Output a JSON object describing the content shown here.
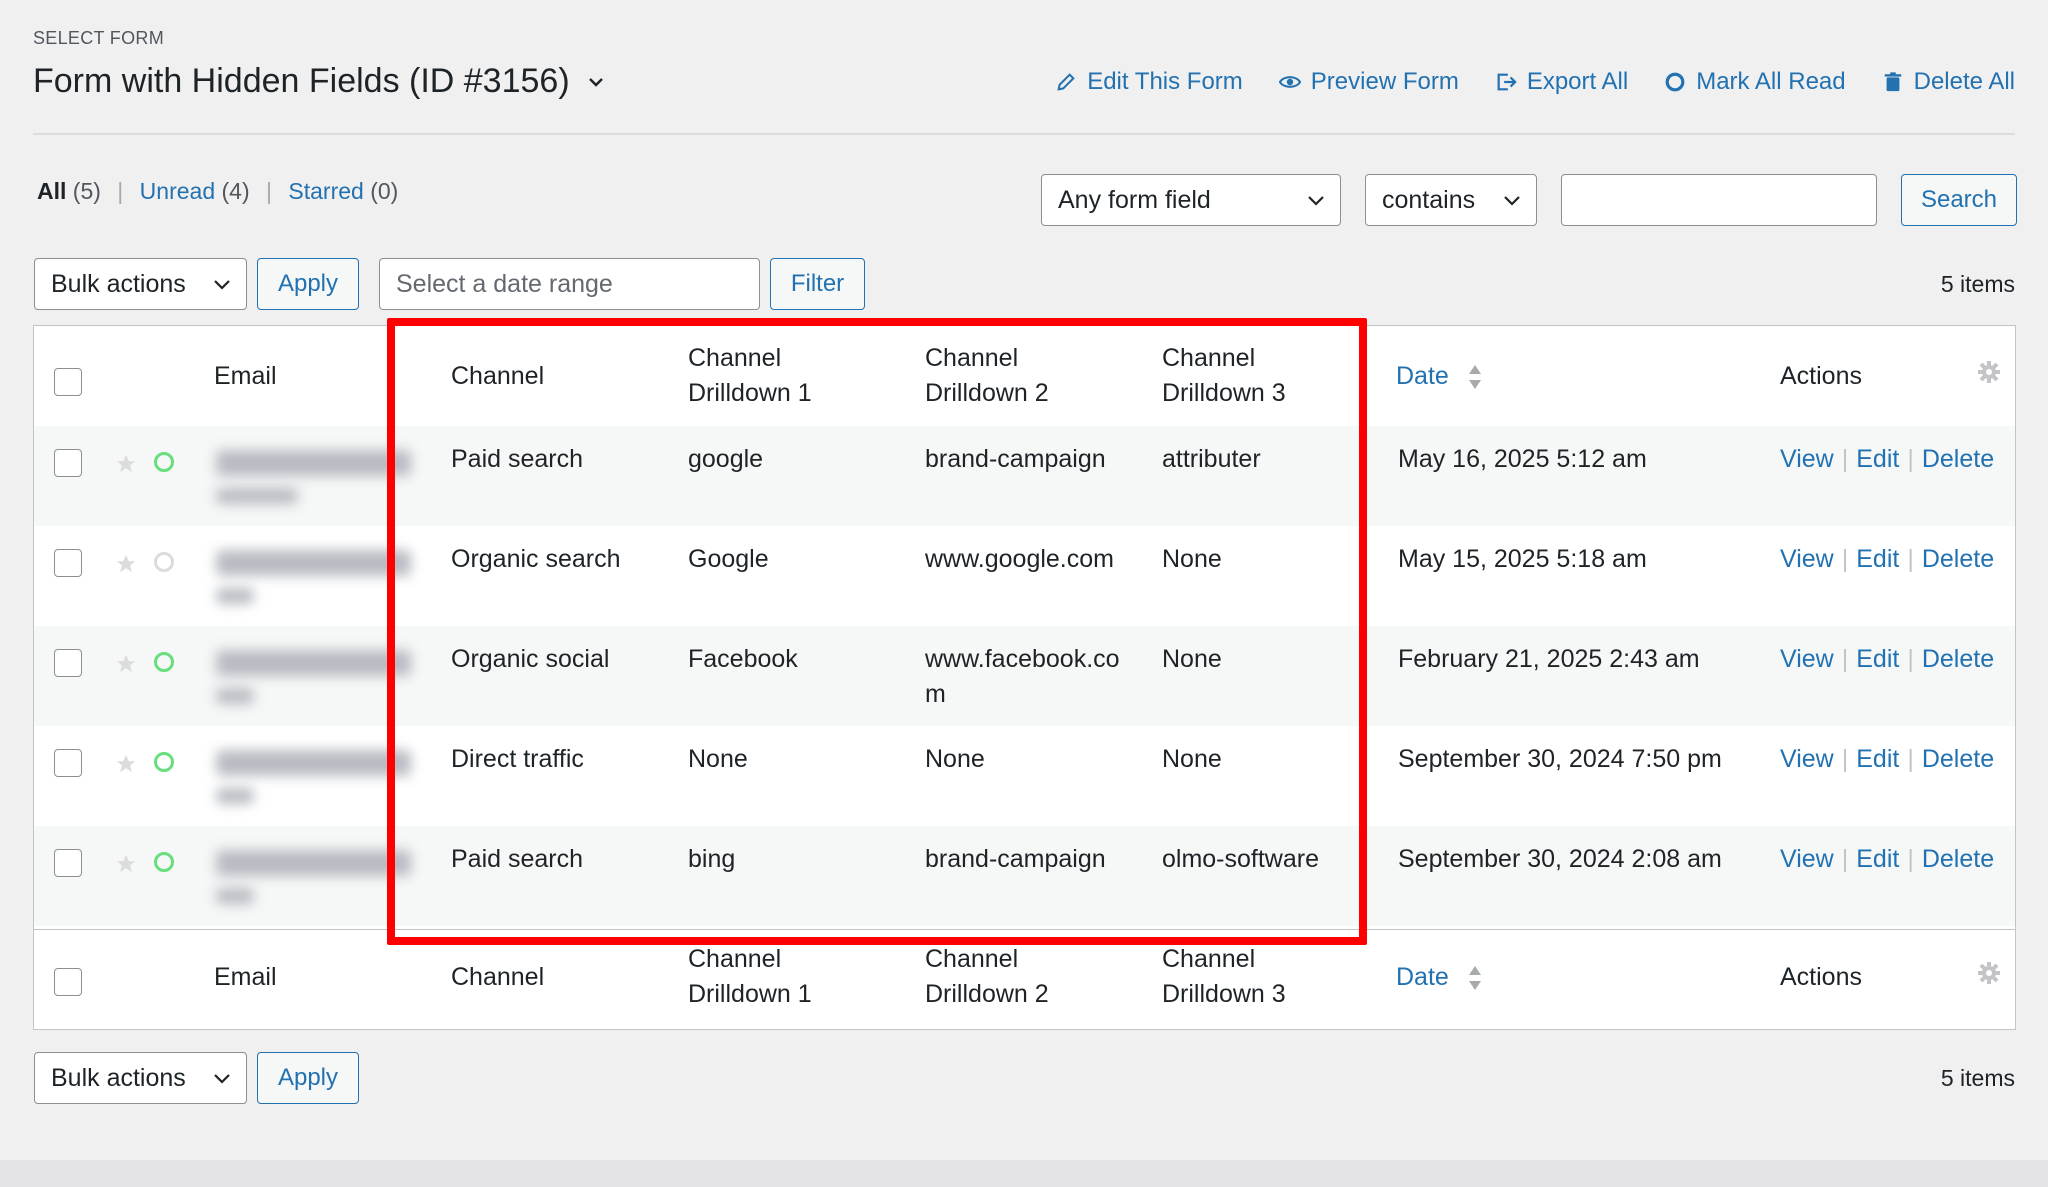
{
  "header": {
    "select_label": "SELECT FORM",
    "form_title": "Form with Hidden Fields (ID #3156)",
    "actions": [
      {
        "label": "Edit This Form",
        "icon": "pencil-icon"
      },
      {
        "label": "Preview Form",
        "icon": "eye-icon"
      },
      {
        "label": "Export All",
        "icon": "export-icon"
      },
      {
        "label": "Mark All Read",
        "icon": "circle-icon"
      },
      {
        "label": "Delete All",
        "icon": "trash-icon"
      }
    ]
  },
  "views": {
    "all_label": "All",
    "all_count": "(5)",
    "unread_label": "Unread",
    "unread_count": "(4)",
    "starred_label": "Starred",
    "starred_count": "(0)",
    "separator": "|"
  },
  "search": {
    "field_select": "Any form field",
    "operator_select": "contains",
    "query": "",
    "button": "Search"
  },
  "toolbar_top": {
    "bulk_actions": "Bulk actions",
    "apply": "Apply",
    "date_placeholder": "Select a date range",
    "filter": "Filter",
    "count": "5 items"
  },
  "toolbar_bottom": {
    "bulk_actions": "Bulk actions",
    "apply": "Apply",
    "count": "5 items"
  },
  "table": {
    "columns": {
      "email": "Email",
      "channel": "Channel",
      "d1_line1": "Channel",
      "d1_line2": "Drilldown 1",
      "d2_line1": "Channel",
      "d2_line2": "Drilldown 2",
      "d3_line1": "Channel",
      "d3_line2": "Drilldown 3",
      "date": "Date",
      "actions": "Actions"
    },
    "row_actions": {
      "view": "View",
      "edit": "Edit",
      "delete": "Delete",
      "sep": "|"
    },
    "rows": [
      {
        "channel": "Paid search",
        "d1": "google",
        "d2": "brand-campaign",
        "d2b": "",
        "d3": "attributer",
        "date": "May 16, 2025 5:12 am",
        "unread": true
      },
      {
        "channel": "Organic search",
        "d1": "Google",
        "d2": "www.google.com",
        "d2b": "",
        "d3": "None",
        "date": "May 15, 2025 5:18 am",
        "unread": false
      },
      {
        "channel": "Organic social",
        "d1": "Facebook",
        "d2": "www.facebook.co",
        "d2b": "m",
        "d3": "None",
        "date": "February 21, 2025 2:43 am",
        "unread": true
      },
      {
        "channel": "Direct traffic",
        "d1": "None",
        "d2": "None",
        "d2b": "",
        "d3": "None",
        "date": "September 30, 2024 7:50 pm",
        "unread": true
      },
      {
        "channel": "Paid search",
        "d1": "bing",
        "d2": "brand-campaign",
        "d2b": "",
        "d3": "olmo-software",
        "date": "September 30, 2024 2:08 am",
        "unread": true
      }
    ]
  },
  "colors": {
    "link": "#2271b1",
    "unread_dot": "#68de7c",
    "highlight_box": "#ff0000"
  }
}
